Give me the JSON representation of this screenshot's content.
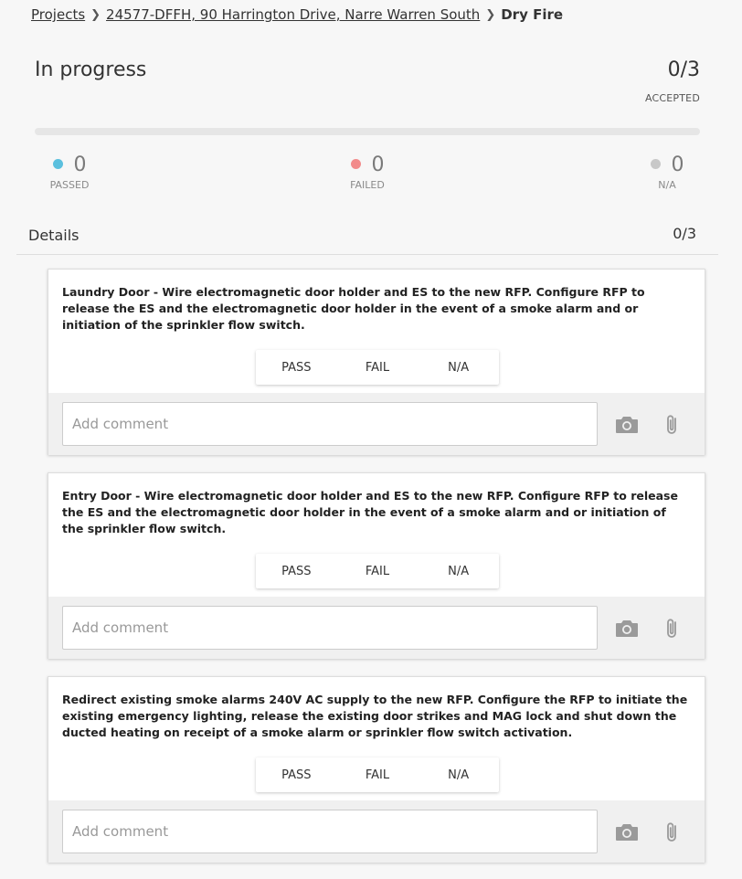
{
  "breadcrumb": {
    "projects": "Projects",
    "project": "24577-DFFH, 90 Harrington Drive, Narre Warren South",
    "current": "Dry Fire",
    "separator": ">"
  },
  "summary": {
    "status": "In progress",
    "accepted_count": "0/3",
    "accepted_label": "ACCEPTED",
    "progress": 0,
    "stats": {
      "passed": {
        "value": "0",
        "label": "PASSED",
        "color": "#5bc0de"
      },
      "failed": {
        "value": "0",
        "label": "FAILED",
        "color": "#f28b8b"
      },
      "na": {
        "value": "0",
        "label": "N/A",
        "color": "#c8c8c8"
      }
    }
  },
  "details": {
    "title": "Details",
    "count": "0/3",
    "items": [
      {
        "description": "Laundry Door - Wire electromagnetic door holder and ES to the new RFP. Configure RFP to release the ES and the electromagnetic door holder in the event of a smoke alarm and or initiation of the sprinkler flow switch.",
        "pass": "PASS",
        "fail": "FAIL",
        "na": "N/A",
        "comment_placeholder": "Add comment"
      },
      {
        "description": "Entry Door - Wire electromagnetic door holder and ES to the new RFP. Configure RFP to release the ES and the electromagnetic door holder in the event of a smoke alarm and or initiation of the sprinkler flow switch.",
        "pass": "PASS",
        "fail": "FAIL",
        "na": "N/A",
        "comment_placeholder": "Add comment"
      },
      {
        "description": "Redirect existing smoke alarms 240V AC supply to the new RFP. Configure the RFP to initiate the existing emergency lighting, release the existing door strikes and MAG lock and shut down the ducted heating on receipt of a smoke alarm or sprinkler flow switch activation.",
        "pass": "PASS",
        "fail": "FAIL",
        "na": "N/A",
        "comment_placeholder": "Add comment"
      }
    ]
  },
  "icons": {
    "camera": "camera-icon",
    "attach": "paperclip-icon"
  }
}
